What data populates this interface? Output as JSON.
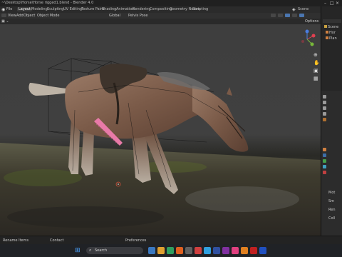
{
  "window": {
    "title": "~\\Desktop\\Horse\\Horse rigged1.blend - Blender 4.0"
  },
  "workspace_tabs": [
    {
      "label": "Layout",
      "active": true
    },
    {
      "label": "Modeling"
    },
    {
      "label": "Sculpting"
    },
    {
      "label": "UV Editing"
    },
    {
      "label": "Texture Paint"
    },
    {
      "label": "Shading"
    },
    {
      "label": "Animation"
    },
    {
      "label": "Rendering"
    },
    {
      "label": "Compositing"
    },
    {
      "label": "Geometry Nodes"
    },
    {
      "label": "Scripting"
    }
  ],
  "menu": {
    "items": [
      "View",
      "Add",
      "Object"
    ],
    "mode": "Object Mode",
    "options_label": "Options",
    "scene_label": "Scene"
  },
  "toolrow": {
    "orientation": "Global",
    "pivot": "Pelvis Pose"
  },
  "outliner": {
    "items": [
      "Scene",
      "Hor",
      "Plan"
    ]
  },
  "properties": {
    "labels": [
      "Mot",
      "Sm",
      "Ren",
      "Coll"
    ]
  },
  "statusbar": {
    "left": "Rename Items",
    "center": "Preferences",
    "right": "Contact"
  },
  "taskbar": {
    "search_placeholder": "Search"
  },
  "colors": {
    "accent": "#3d6ea8",
    "background": "#1d1d1d",
    "viewport_sky": "#404040"
  }
}
